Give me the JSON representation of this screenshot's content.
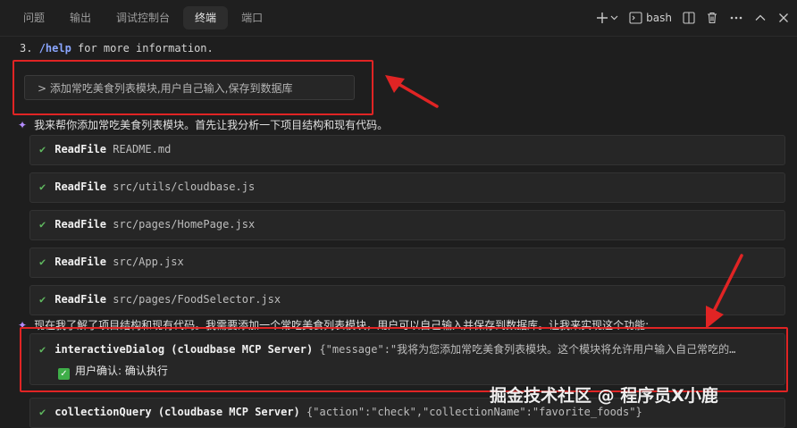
{
  "tabs": [
    {
      "label": "问题"
    },
    {
      "label": "输出"
    },
    {
      "label": "调试控制台"
    },
    {
      "label": "终端",
      "active": true
    },
    {
      "label": "端口"
    }
  ],
  "toolbar": {
    "bash_label": "bash"
  },
  "terminal": {
    "help_prefix": "3. ",
    "help_cmd": "/help",
    "help_suffix": " for more information.",
    "prompt": "> 添加常吃美食列表模块,用户自己输入,保存到数据库",
    "ai_msg_1": "我来帮你添加常吃美食列表模块。首先让我分析一下项目结构和现有代码。",
    "reads": [
      {
        "tool": "ReadFile",
        "arg": "README.md"
      },
      {
        "tool": "ReadFile",
        "arg": "src/utils/cloudbase.js"
      },
      {
        "tool": "ReadFile",
        "arg": "src/pages/HomePage.jsx"
      },
      {
        "tool": "ReadFile",
        "arg": "src/App.jsx"
      },
      {
        "tool": "ReadFile",
        "arg": "src/pages/FoodSelector.jsx"
      }
    ],
    "ai_msg_2": "现在我了解了项目结构和现有代码。我需要添加一个常吃美食列表模块，用户可以自己输入并保存到数据库。让我来实现这个功能:",
    "dialog_tool": "interactiveDialog (cloudbase MCP Server)",
    "dialog_arg": "{\"message\":\"我将为您添加常吃美食列表模块。这个模块将允许用户输入自己常吃的…",
    "confirm_text": "用户确认: 确认执行",
    "query_tool": "collectionQuery (cloudbase MCP Server)",
    "query_arg": "{\"action\":\"check\",\"collectionName\":\"favorite_foods\"}"
  },
  "watermark": "掘金技术社区 @ 程序员X小鹿",
  "colors": {
    "annotation": "#e02424",
    "check": "#5fb85f",
    "sparkle": "#b48cff",
    "help_cmd": "#8aa6ff"
  }
}
